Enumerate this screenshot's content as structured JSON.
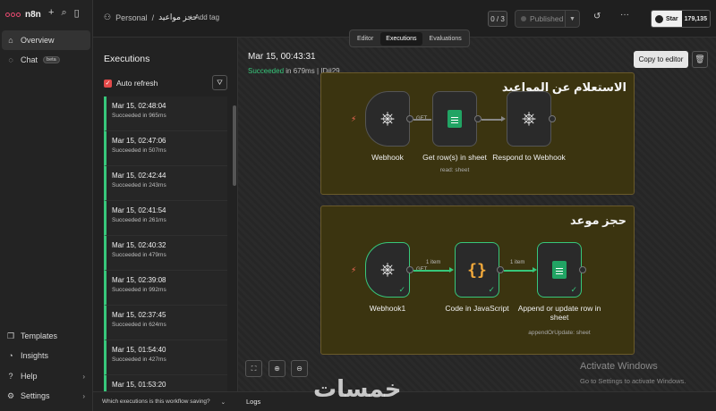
{
  "brand": {
    "name": "n8n"
  },
  "nav": {
    "overview": "Overview",
    "chat": "Chat",
    "chat_badge": "beta",
    "templates": "Templates",
    "insights": "Insights",
    "help": "Help",
    "settings": "Settings"
  },
  "header": {
    "project": "Personal",
    "separator": "/",
    "workflow_name": "حجز مواعيد",
    "add_tag": "+ Add tag",
    "counter": "0 / 3",
    "published": "Published",
    "github_star": "Star",
    "github_count": "179,135"
  },
  "tabs": [
    "Editor",
    "Executions",
    "Evaluations"
  ],
  "executions": {
    "title": "Executions",
    "auto_refresh": "Auto refresh",
    "items": [
      {
        "time": "Mar 15, 02:48:04",
        "status": "Succeeded in 965ms"
      },
      {
        "time": "Mar 15, 02:47:06",
        "status": "Succeeded in 507ms"
      },
      {
        "time": "Mar 15, 02:42:44",
        "status": "Succeeded in 243ms"
      },
      {
        "time": "Mar 15, 02:41:54",
        "status": "Succeeded in 261ms"
      },
      {
        "time": "Mar 15, 02:40:32",
        "status": "Succeeded in 479ms"
      },
      {
        "time": "Mar 15, 02:39:08",
        "status": "Succeeded in 992ms"
      },
      {
        "time": "Mar 15, 02:37:45",
        "status": "Succeeded in 624ms"
      },
      {
        "time": "Mar 15, 01:54:40",
        "status": "Succeeded in 427ms"
      },
      {
        "time": "Mar 15, 01:53:20",
        "status": ""
      }
    ],
    "saving_question": "Which executions is this workflow saving?"
  },
  "detail": {
    "date": "Mar 15, 00:43:31",
    "status_ok": "Succeeded",
    "status_rest": " in 679ms | ID#29",
    "copy_to_editor": "Copy to editor"
  },
  "groups": [
    {
      "title": "الاستعلام عن المواعيد",
      "nodes": [
        {
          "label": "Webhook",
          "sub": ""
        },
        {
          "label": "Get row(s) in sheet",
          "sub": "read: sheet"
        },
        {
          "label": "Respond to Webhook",
          "sub": ""
        }
      ],
      "wire_tag": "GET"
    },
    {
      "title": "حجز موعد",
      "nodes": [
        {
          "label": "Webhook1",
          "sub": ""
        },
        {
          "label": "Code in JavaScript",
          "sub": ""
        },
        {
          "label": "Append or update row in sheet",
          "sub": "appendOrUpdate: sheet"
        }
      ],
      "wire_tag": "GET",
      "item_label_1": "1 item",
      "item_label_2": "1 item"
    }
  ],
  "logs": "Logs",
  "windows": {
    "title": "Activate Windows",
    "sub": "Go to Settings to activate Windows."
  },
  "watermark": "خمسات",
  "colors": {
    "success": "#37c77b",
    "accent": "#ea4b71",
    "group_bg": "#3b3410",
    "sheets": "#21a464",
    "code": "#f2a93b"
  }
}
